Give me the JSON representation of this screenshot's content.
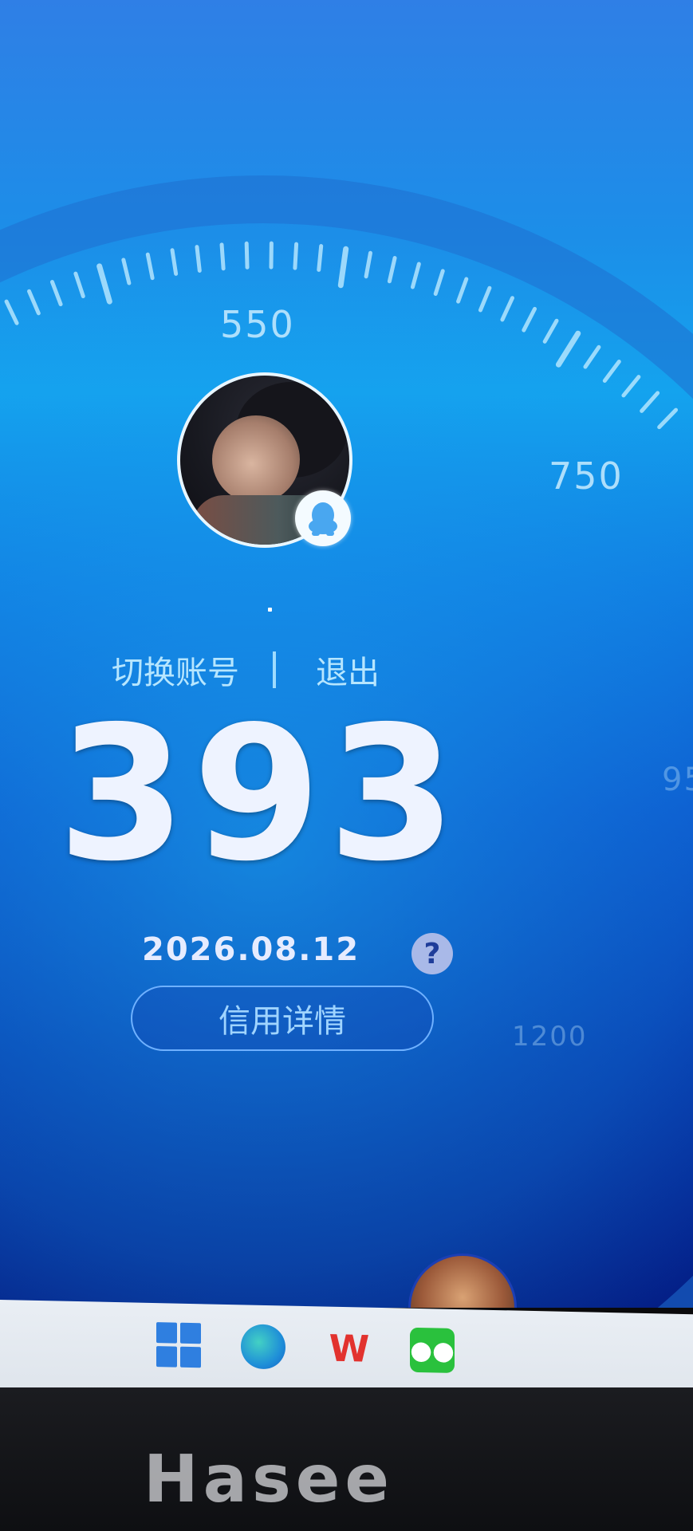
{
  "gauge": {
    "labels": [
      "550",
      "750",
      "95",
      "1200"
    ]
  },
  "user": {
    "avatar_icon": "user-avatar",
    "badge_icon": "qq-penguin-icon"
  },
  "account": {
    "switch_label": "切换账号",
    "logout_label": "退出"
  },
  "score": {
    "value": "393",
    "date": "2026.08.12",
    "help_icon_text": "?"
  },
  "detail_button": {
    "label": "信用详情"
  },
  "taskbar": {
    "icons": [
      "windows-start-icon",
      "edge-browser-icon",
      "wps-icon",
      "wechat-icon"
    ]
  },
  "monitor": {
    "brand": "Hasee"
  },
  "colors": {
    "accent": "#14a3ee",
    "deep": "#041f86",
    "score_text": "#eef3ff"
  }
}
